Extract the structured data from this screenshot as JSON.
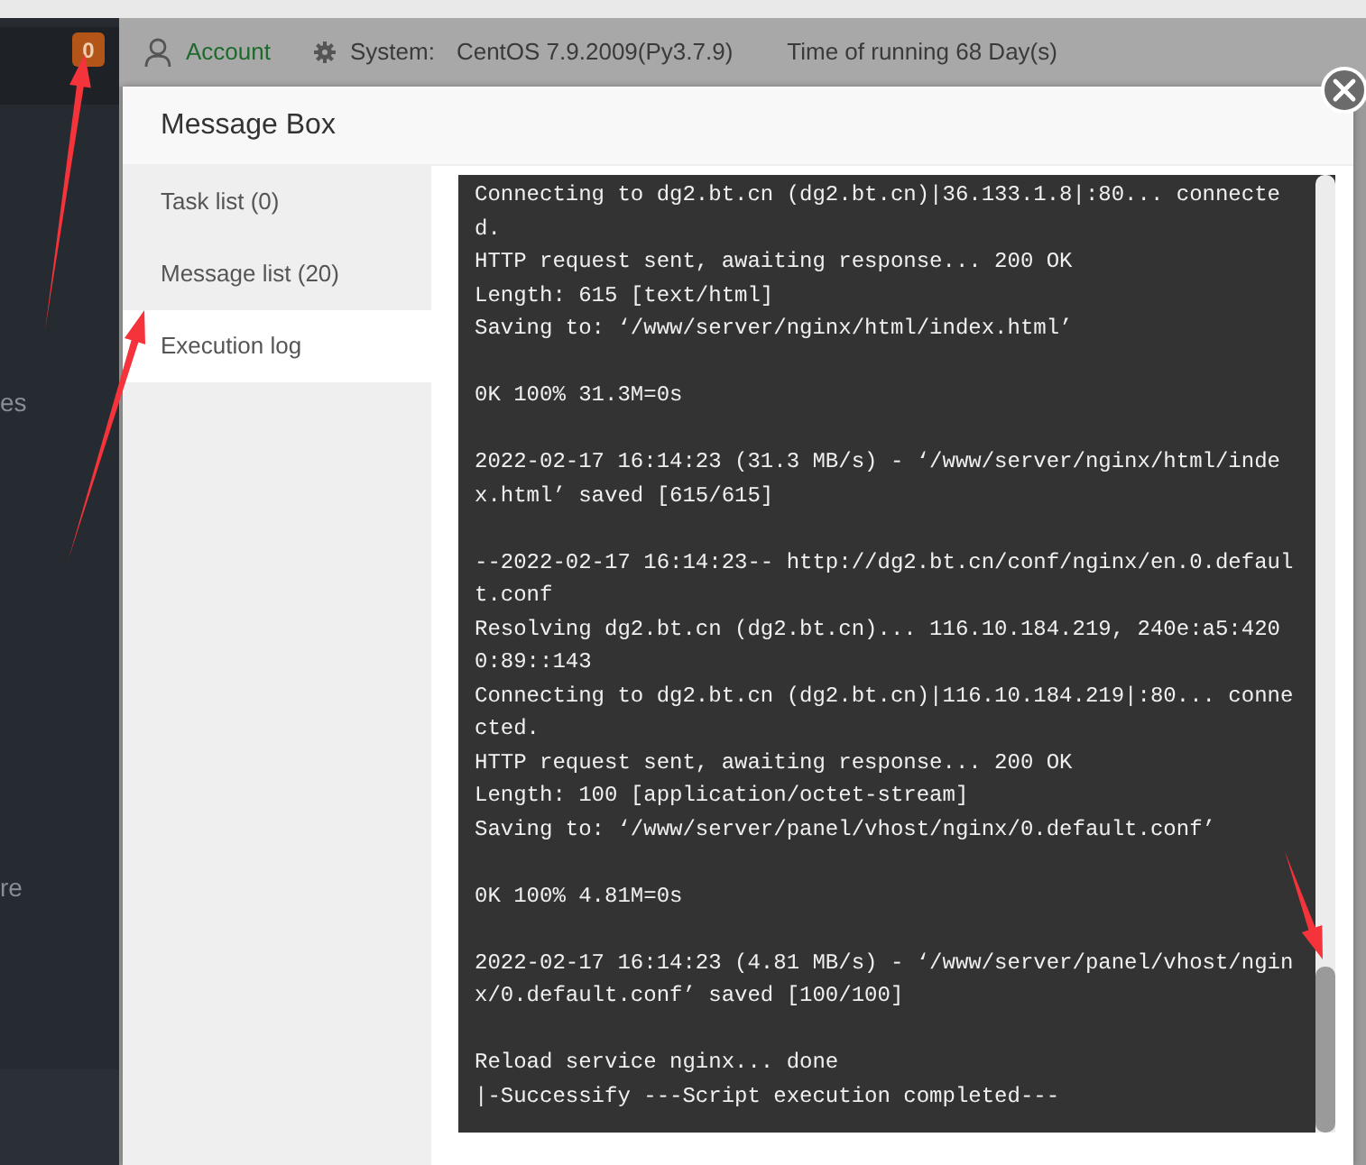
{
  "sidebar": {
    "badge": "0",
    "fragments": [
      "es",
      "re"
    ]
  },
  "topbar": {
    "account": "Account",
    "system_label": "System:",
    "system_value": "CentOS 7.9.2009(Py3.7.9)",
    "uptime": "Time of running 68 Day(s)"
  },
  "modal": {
    "title": "Message Box",
    "tabs": [
      {
        "label": "Task list (0)",
        "selected": false
      },
      {
        "label": "Message list (20)",
        "selected": false
      },
      {
        "label": "Execution log",
        "selected": true
      }
    ],
    "log": [
      [
        "Connecting to dg2.bt.cn (dg2.bt.cn)|36.133.1.8|:80... connecte",
        "d.",
        "HTTP request sent, awaiting response... 200 OK",
        "Length: 615 [text/html]",
        "Saving to: ‘/www/server/nginx/html/index.html’"
      ],
      [
        "0K 100% 31.3M=0s"
      ],
      [
        "2022-02-17 16:14:23 (31.3 MB/s) - ‘/www/server/nginx/html/inde",
        "x.html’ saved [615/615]"
      ],
      [
        "--2022-02-17 16:14:23-- http://dg2.bt.cn/conf/nginx/en.0.defaul",
        "t.conf",
        "Resolving dg2.bt.cn (dg2.bt.cn)... 116.10.184.219, 240e:a5:420",
        "0:89::143",
        "Connecting to dg2.bt.cn (dg2.bt.cn)|116.10.184.219|:80... conne",
        "cted.",
        "HTTP request sent, awaiting response... 200 OK",
        "Length: 100 [application/octet-stream]",
        "Saving to: ‘/www/server/panel/vhost/nginx/0.default.conf’"
      ],
      [
        "0K 100% 4.81M=0s"
      ],
      [
        "2022-02-17 16:14:23 (4.81 MB/s) - ‘/www/server/panel/vhost/ngin",
        "x/0.default.conf’ saved [100/100]"
      ],
      [
        "Reload service nginx... done",
        "|-Successify ---Script execution completed---"
      ]
    ]
  },
  "annotations": [
    {
      "kind": "arrow"
    },
    {
      "kind": "arrow"
    },
    {
      "kind": "arrow"
    }
  ]
}
